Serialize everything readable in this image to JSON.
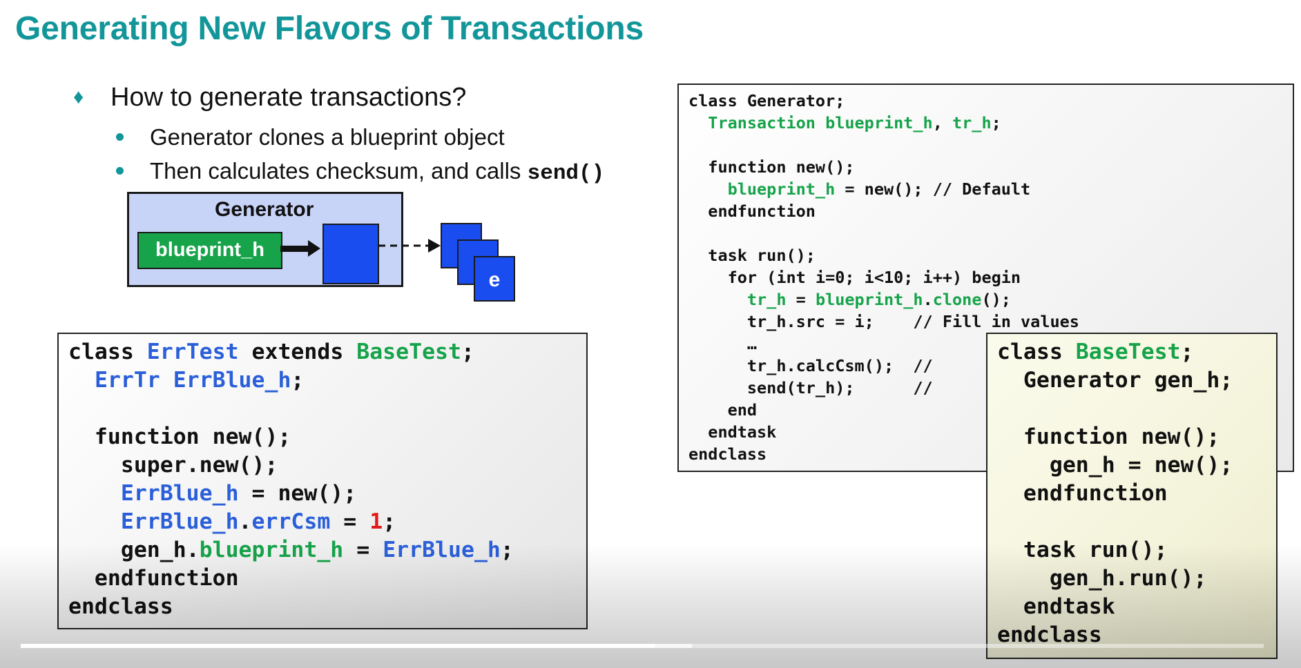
{
  "title": "Generating New Flavors of Transactions",
  "bullets": {
    "main": "How to generate transactions?",
    "sub1": "Generator clones a blueprint object",
    "sub2_prefix": "Then calculates checksum, and calls ",
    "sub2_code": "send()"
  },
  "diagram": {
    "generator_label": "Generator",
    "blueprint_label": "blueprint_h",
    "stack_label": "e"
  },
  "colors": {
    "title": "#12969a",
    "green": "#16a34a",
    "blue": "#2b5fd9",
    "red": "#e01b1b",
    "diagram_blue": "#1a4df0",
    "generator_bg": "#c8d3f8",
    "basetest_bg": "#f4f4dc"
  },
  "code_generator": [
    [
      {
        "t": "class Generator;"
      }
    ],
    [
      {
        "t": "  "
      },
      {
        "t": "Transaction blueprint_h",
        "c": "green"
      },
      {
        "t": ", "
      },
      {
        "t": "tr_h",
        "c": "green"
      },
      {
        "t": ";"
      }
    ],
    [
      {
        "t": ""
      }
    ],
    [
      {
        "t": "  function new();"
      }
    ],
    [
      {
        "t": "    "
      },
      {
        "t": "blueprint_h",
        "c": "green"
      },
      {
        "t": " = new(); // Default"
      }
    ],
    [
      {
        "t": "  endfunction"
      }
    ],
    [
      {
        "t": ""
      }
    ],
    [
      {
        "t": "  task run();"
      }
    ],
    [
      {
        "t": "    for (int i=0; i<10; i++) begin"
      }
    ],
    [
      {
        "t": "      "
      },
      {
        "t": "tr_h",
        "c": "green"
      },
      {
        "t": " = "
      },
      {
        "t": "blueprint_h",
        "c": "green"
      },
      {
        "t": "."
      },
      {
        "t": "clone",
        "c": "green"
      },
      {
        "t": "();"
      }
    ],
    [
      {
        "t": "      tr_h.src = i;    // Fill in values"
      }
    ],
    [
      {
        "t": "      …"
      }
    ],
    [
      {
        "t": "      tr_h.calcCsm();  //"
      }
    ],
    [
      {
        "t": "      send(tr_h);      //"
      }
    ],
    [
      {
        "t": "    end"
      }
    ],
    [
      {
        "t": "  endtask"
      }
    ],
    [
      {
        "t": "endclass"
      }
    ]
  ],
  "code_errtest": [
    [
      {
        "t": "class "
      },
      {
        "t": "ErrTest",
        "c": "blue"
      },
      {
        "t": " extends "
      },
      {
        "t": "BaseTest",
        "c": "green"
      },
      {
        "t": ";"
      }
    ],
    [
      {
        "t": "  "
      },
      {
        "t": "ErrTr ErrBlue_h",
        "c": "blue"
      },
      {
        "t": ";"
      }
    ],
    [
      {
        "t": ""
      }
    ],
    [
      {
        "t": "  function new();"
      }
    ],
    [
      {
        "t": "    super.new();"
      }
    ],
    [
      {
        "t": "    "
      },
      {
        "t": "ErrBlue_h",
        "c": "blue"
      },
      {
        "t": " = new();"
      }
    ],
    [
      {
        "t": "    "
      },
      {
        "t": "ErrBlue_h",
        "c": "blue"
      },
      {
        "t": "."
      },
      {
        "t": "errCsm",
        "c": "blue"
      },
      {
        "t": " = "
      },
      {
        "t": "1",
        "c": "red"
      },
      {
        "t": ";"
      }
    ],
    [
      {
        "t": "    gen_h."
      },
      {
        "t": "blueprint_h",
        "c": "green"
      },
      {
        "t": " = "
      },
      {
        "t": "ErrBlue_h",
        "c": "blue"
      },
      {
        "t": ";"
      }
    ],
    [
      {
        "t": "  endfunction"
      }
    ],
    [
      {
        "t": "endclass"
      }
    ]
  ],
  "code_basetest": [
    [
      {
        "t": "class "
      },
      {
        "t": "BaseTest",
        "c": "green"
      },
      {
        "t": ";"
      }
    ],
    [
      {
        "t": "  Generator gen_h;"
      }
    ],
    [
      {
        "t": ""
      }
    ],
    [
      {
        "t": "  function new();"
      }
    ],
    [
      {
        "t": "    gen_h = new();"
      }
    ],
    [
      {
        "t": "  endfunction"
      }
    ],
    [
      {
        "t": ""
      }
    ],
    [
      {
        "t": "  task run();"
      }
    ],
    [
      {
        "t": "    gen_h.run();"
      }
    ],
    [
      {
        "t": "  endtask"
      }
    ],
    [
      {
        "t": "endclass"
      }
    ]
  ],
  "video_progress": {
    "played": 0.51,
    "buffered": 0.54
  }
}
